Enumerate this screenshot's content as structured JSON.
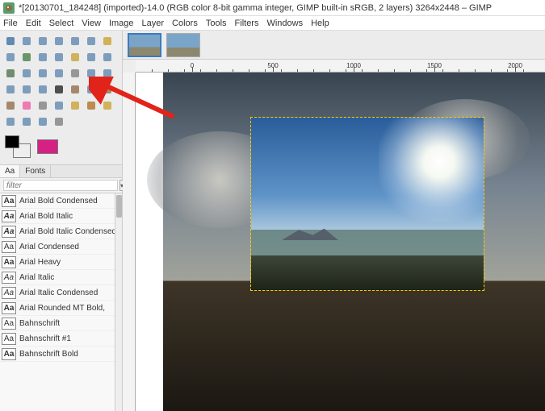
{
  "window": {
    "title": "*[20130701_184248] (imported)-14.0 (RGB color 8-bit gamma integer, GIMP built-in sRGB, 2 layers) 3264x2448 – GIMP"
  },
  "menu": [
    "File",
    "Edit",
    "Select",
    "View",
    "Image",
    "Layer",
    "Colors",
    "Tools",
    "Filters",
    "Windows",
    "Help"
  ],
  "tools": [
    {
      "name": "move-tool",
      "color": "#4a79a8"
    },
    {
      "name": "rect-select-tool",
      "color": "#6a8fb4"
    },
    {
      "name": "ellipse-select-tool",
      "color": "#6a8fb4"
    },
    {
      "name": "free-select-tool",
      "color": "#6a8fb4"
    },
    {
      "name": "fuzzy-select-tool",
      "color": "#6a8fb4"
    },
    {
      "name": "by-color-select-tool",
      "color": "#6a8fb4"
    },
    {
      "name": "scissors-tool",
      "color": "#cda842"
    },
    {
      "name": "foreground-select-tool",
      "color": "#6a8fb4"
    },
    {
      "name": "paths-tool",
      "color": "#548754"
    },
    {
      "name": "color-picker-tool",
      "color": "#6a8fb4"
    },
    {
      "name": "zoom-tool",
      "color": "#6a8fb4"
    },
    {
      "name": "measure-tool",
      "color": "#cda842"
    },
    {
      "name": "crop-tool",
      "color": "#6a8fb4"
    },
    {
      "name": "unified-transform-tool",
      "color": "#6a8fb4"
    },
    {
      "name": "rotate-tool",
      "color": "#5a7d5a"
    },
    {
      "name": "scale-tool",
      "color": "#6a8fb4"
    },
    {
      "name": "shear-tool",
      "color": "#6a8fb4"
    },
    {
      "name": "perspective-tool",
      "color": "#6a8fb4"
    },
    {
      "name": "flip-tool",
      "color": "#888"
    },
    {
      "name": "cage-tool",
      "color": "#6a8fb4"
    },
    {
      "name": "handle-transform-tool",
      "color": "#6a8fb4"
    },
    {
      "name": "warp-tool",
      "color": "#6a8fb4"
    },
    {
      "name": "align-tool",
      "color": "#6a8fb4"
    },
    {
      "name": "3d-transform-tool",
      "color": "#6a8fb4"
    },
    {
      "name": "text-tool",
      "color": "#333"
    },
    {
      "name": "bucket-fill-tool",
      "color": "#997755"
    },
    {
      "name": "gradient-tool",
      "color": "#6a8fb4"
    },
    {
      "name": "pencil-tool",
      "color": "#997755"
    },
    {
      "name": "paintbrush-tool",
      "color": "#997755"
    },
    {
      "name": "eraser-tool",
      "color": "#e6a"
    },
    {
      "name": "airbrush-tool",
      "color": "#888"
    },
    {
      "name": "ink-tool",
      "color": "#6a8fb4"
    },
    {
      "name": "mypaint-brush-tool",
      "color": "#cda842"
    },
    {
      "name": "clone-tool",
      "color": "#b47a35"
    },
    {
      "name": "heal-tool",
      "color": "#cda842"
    },
    {
      "name": "perspective-clone-tool",
      "color": "#6a8fb4"
    },
    {
      "name": "blur-tool",
      "color": "#6a8fb4"
    },
    {
      "name": "smudge-tool",
      "color": "#6a8fb4"
    },
    {
      "name": "dodge-burn-tool",
      "color": "#888"
    }
  ],
  "swatches": {
    "fg": "#000000",
    "bg": "#eeeeee",
    "accent": "#d62084"
  },
  "font_panel": {
    "tabs": [
      "Aa",
      "Fonts"
    ],
    "filter_placeholder": "filter",
    "fonts": [
      {
        "name": "Arial Bold Condensed",
        "style": "b"
      },
      {
        "name": "Arial Bold Italic",
        "style": "bi"
      },
      {
        "name": "Arial Bold Italic Condensed",
        "style": "bi"
      },
      {
        "name": "Arial Condensed",
        "style": ""
      },
      {
        "name": "Arial Heavy",
        "style": "b"
      },
      {
        "name": "Arial Italic",
        "style": "i"
      },
      {
        "name": "Arial Italic Condensed",
        "style": "i"
      },
      {
        "name": "Arial Rounded MT Bold,",
        "style": "b"
      },
      {
        "name": "Bahnschrift",
        "style": ""
      },
      {
        "name": "Bahnschrift #1",
        "style": ""
      },
      {
        "name": "Bahnschrift Bold",
        "style": "b"
      }
    ]
  },
  "ruler_ticks": [
    {
      "pos": 70,
      "label": "0"
    },
    {
      "pos": 170,
      "label": "500"
    },
    {
      "pos": 270,
      "label": "1000"
    },
    {
      "pos": 370,
      "label": "1500"
    },
    {
      "pos": 470,
      "label": "2000"
    }
  ]
}
